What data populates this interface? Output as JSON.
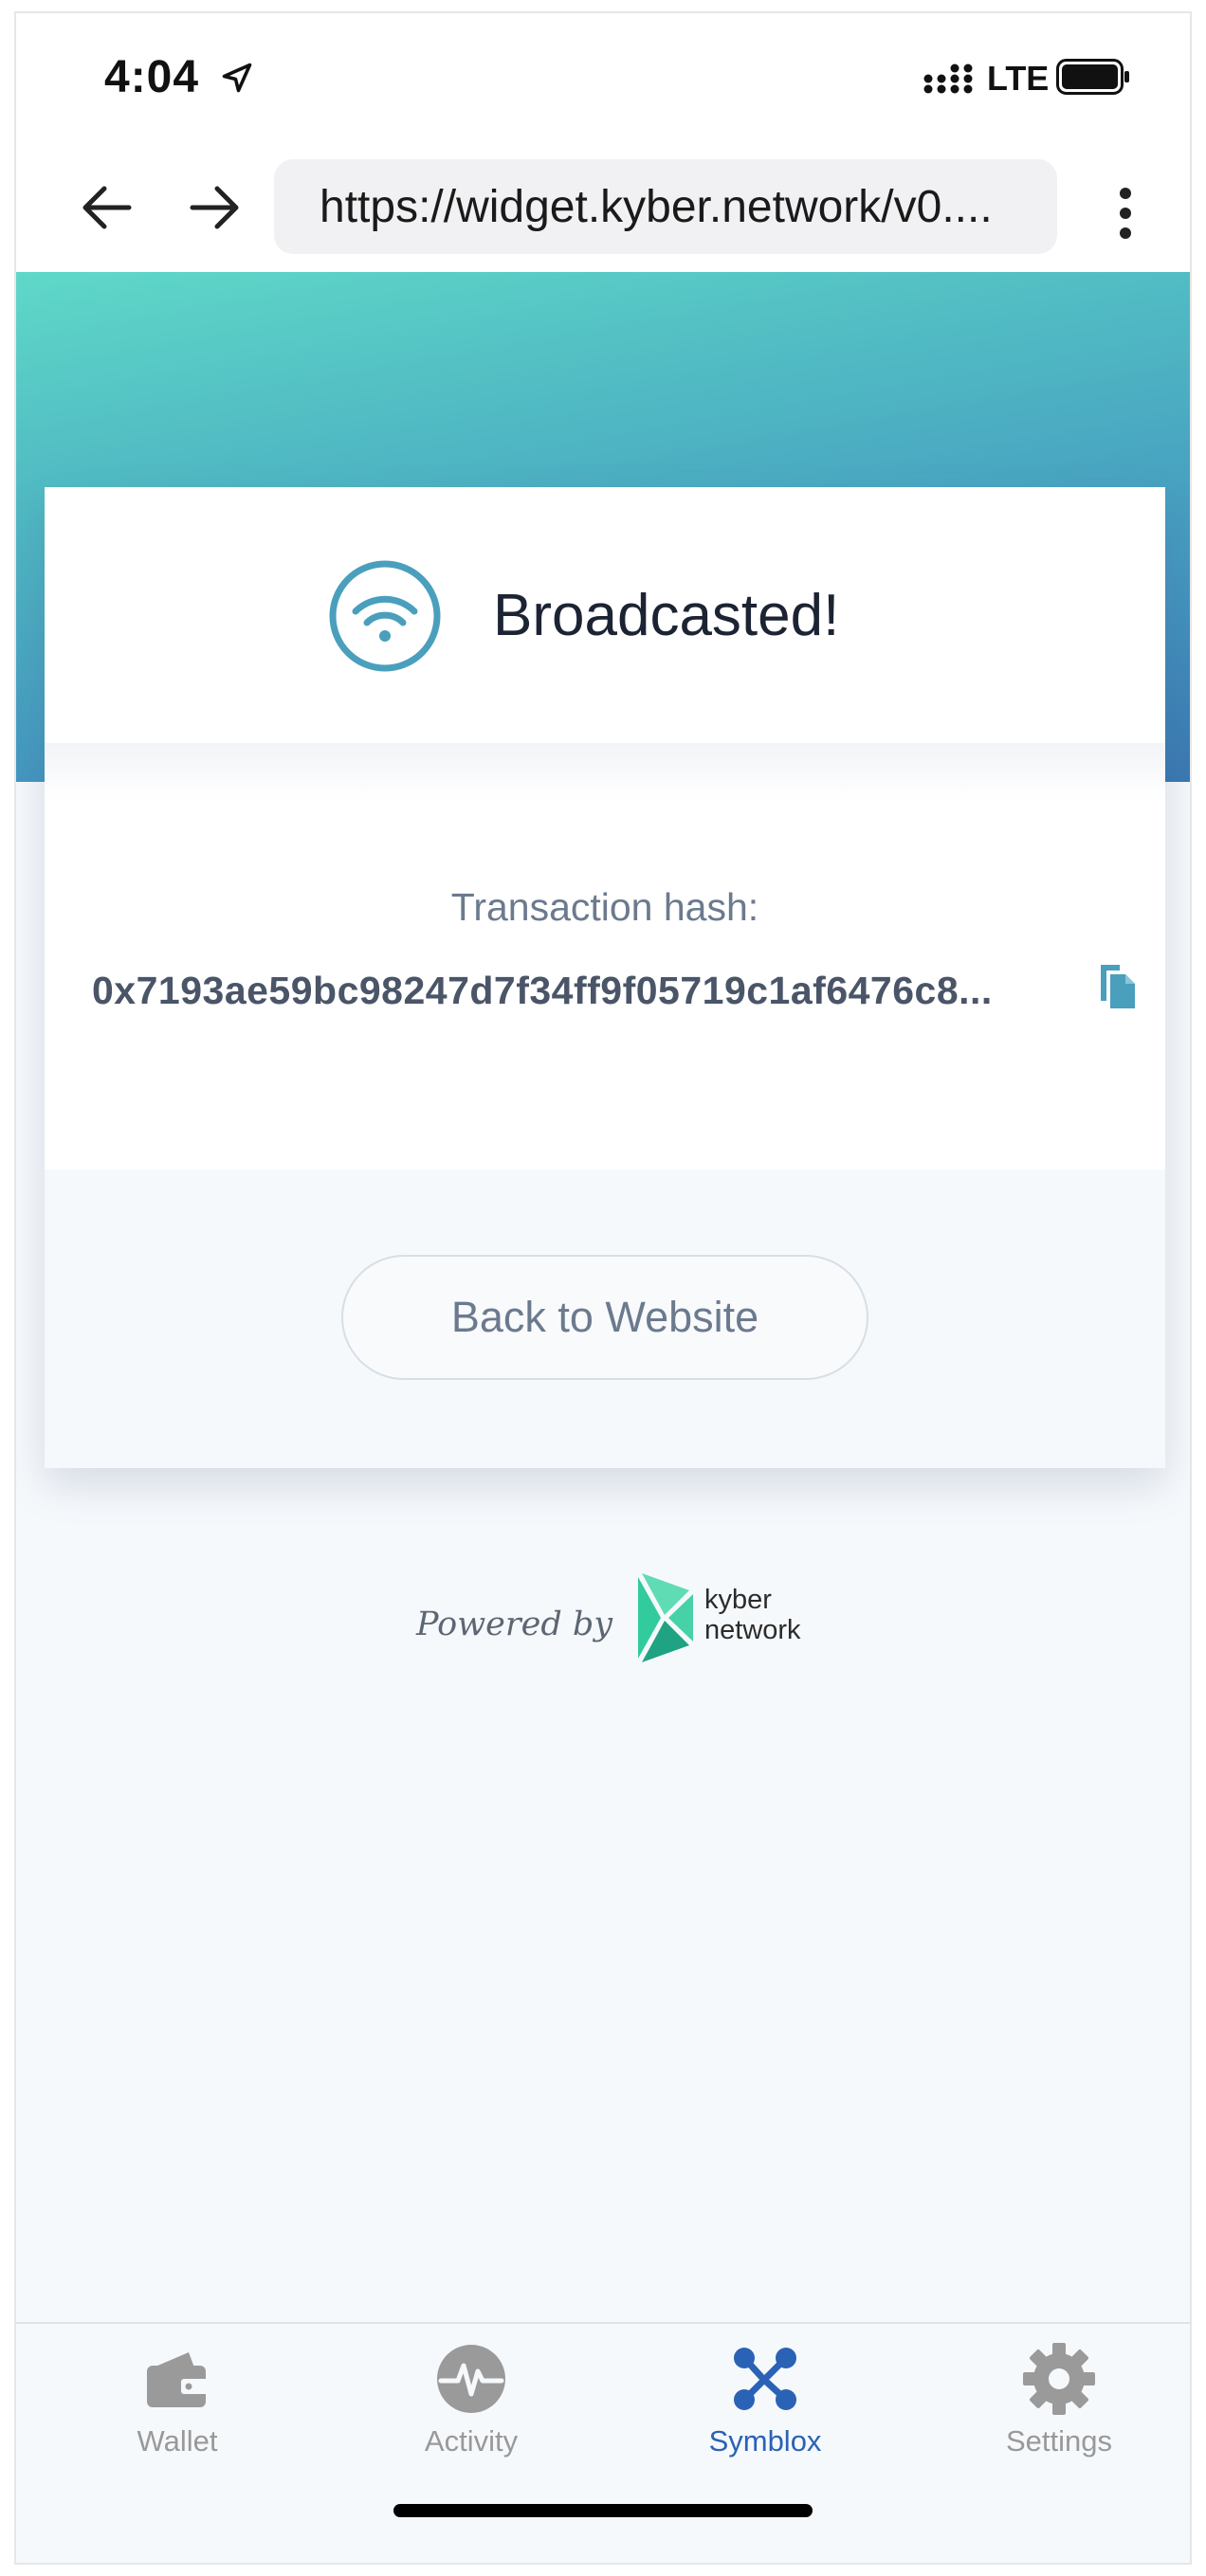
{
  "status_bar": {
    "time": "4:04",
    "network": "LTE"
  },
  "browser": {
    "url": "https://widget.kyber.network/v0...."
  },
  "card": {
    "title": "Broadcasted!",
    "hash_label": "Transaction hash:",
    "hash_value": "0x7193ae59bc98247d7f34ff9f05719c1af6476c8...",
    "back_button": "Back to Website"
  },
  "footer": {
    "powered_by": "Powered by",
    "brand_line1": "kyber",
    "brand_line2": "network"
  },
  "tabs": [
    {
      "label": "Wallet",
      "icon": "wallet-icon",
      "active": false
    },
    {
      "label": "Activity",
      "icon": "activity-icon",
      "active": false
    },
    {
      "label": "Symblox",
      "icon": "symblox-icon",
      "active": true
    },
    {
      "label": "Settings",
      "icon": "gear-icon",
      "active": false
    }
  ],
  "colors": {
    "accent": "#2a62b5",
    "hero_start": "#5fd8c8",
    "hero_end": "#3a78b2",
    "wifi": "#4a9fbd",
    "kyber_green": "#31cb9e"
  }
}
